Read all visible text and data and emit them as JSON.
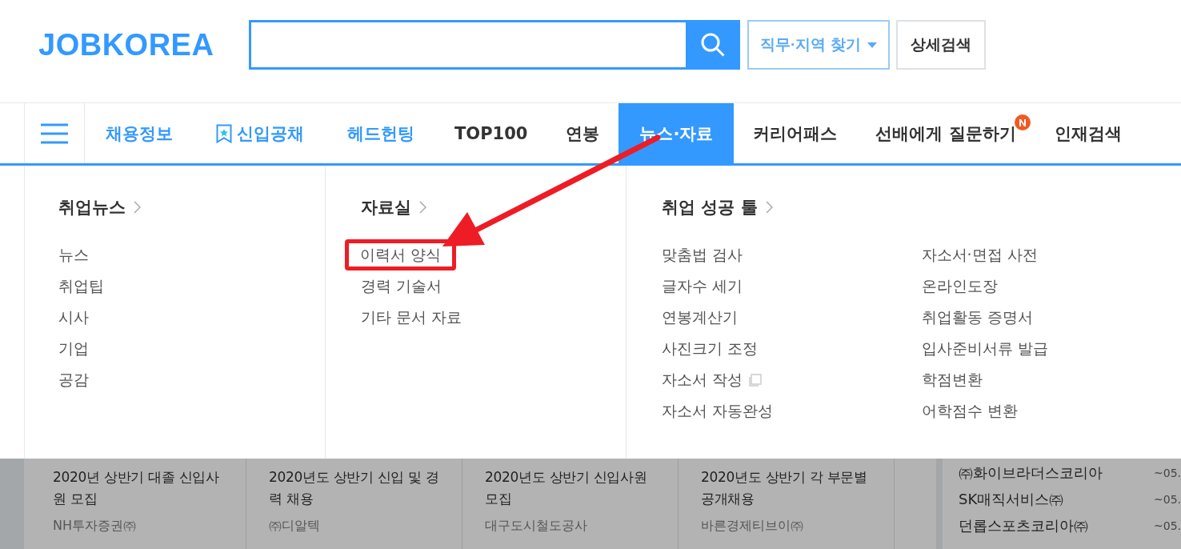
{
  "header": {
    "logo": "JOBKOREA",
    "buttons": [
      {
        "label": "직무·지역 찾기",
        "kind": "dropdown"
      },
      {
        "label": "상세검색",
        "kind": "plain"
      }
    ]
  },
  "nav": {
    "items": [
      {
        "label": "채용정보",
        "accent": true,
        "selected": false
      },
      {
        "label": "신입공채",
        "accent": true,
        "selected": false,
        "kind": "badge-icon"
      },
      {
        "label": "헤드헌팅",
        "accent": true,
        "selected": false
      },
      {
        "label": "TOP100",
        "accent": false,
        "selected": false
      },
      {
        "label": "연봉",
        "accent": false,
        "selected": false
      },
      {
        "label": "뉴스·자료",
        "accent": false,
        "selected": true
      },
      {
        "label": "커리어패스",
        "accent": false,
        "selected": false
      },
      {
        "label": "선배에게 질문하기",
        "accent": false,
        "selected": false,
        "kind": "new"
      },
      {
        "label": "인재검색",
        "accent": false,
        "selected": false
      }
    ]
  },
  "mega_menu": {
    "sections": [
      {
        "title": "취업뉴스",
        "columns": [
          [
            {
              "label": "뉴스"
            },
            {
              "label": "취업팁"
            },
            {
              "label": "시사"
            },
            {
              "label": "기업"
            },
            {
              "label": "공감"
            }
          ]
        ]
      },
      {
        "title": "자료실",
        "columns": [
          [
            {
              "label": "이력서 양식",
              "highlighted": true
            },
            {
              "label": "경력 기술서",
              "highlighted": false
            },
            {
              "label": "기타 문서 자료",
              "highlighted": false
            }
          ]
        ]
      },
      {
        "title": "취업 성공 툴",
        "columns": [
          [
            {
              "label": "맞춤법 검사"
            },
            {
              "label": "글자수 세기"
            },
            {
              "label": "연봉계산기"
            },
            {
              "label": "사진크기 조정"
            },
            {
              "label": "자소서 작성",
              "kind": "popup"
            },
            {
              "label": "자소서 자동완성"
            }
          ],
          [
            {
              "label": "자소서·면접 사전"
            },
            {
              "label": "온라인도장"
            },
            {
              "label": "취업활동 증명서"
            },
            {
              "label": "입사준비서류 발급"
            },
            {
              "label": "학점변환"
            },
            {
              "label": "어학점수 변환"
            }
          ]
        ]
      }
    ]
  },
  "job_cards": [
    {
      "title": "2020년 상반기 대졸 신입사원 모집",
      "company": "NH투자증권㈜"
    },
    {
      "title": "2020년도 상반기 신입 및 경력 채용",
      "company": "㈜디알텍"
    },
    {
      "title": "2020년도 상반기 신입사원 모집",
      "company": "대구도시철도공사"
    },
    {
      "title": "2020년도 상반기 각 부문별 공개채용",
      "company": "바른경제티브이㈜"
    }
  ],
  "company_list": [
    {
      "name": "㈜화이브라더스코리아",
      "date": "~05."
    },
    {
      "name": "SK매직서비스㈜",
      "date": "~05."
    },
    {
      "name": "던롭스포츠코리아㈜",
      "date": "~05."
    }
  ],
  "annotation": {
    "kind": "arrow"
  }
}
